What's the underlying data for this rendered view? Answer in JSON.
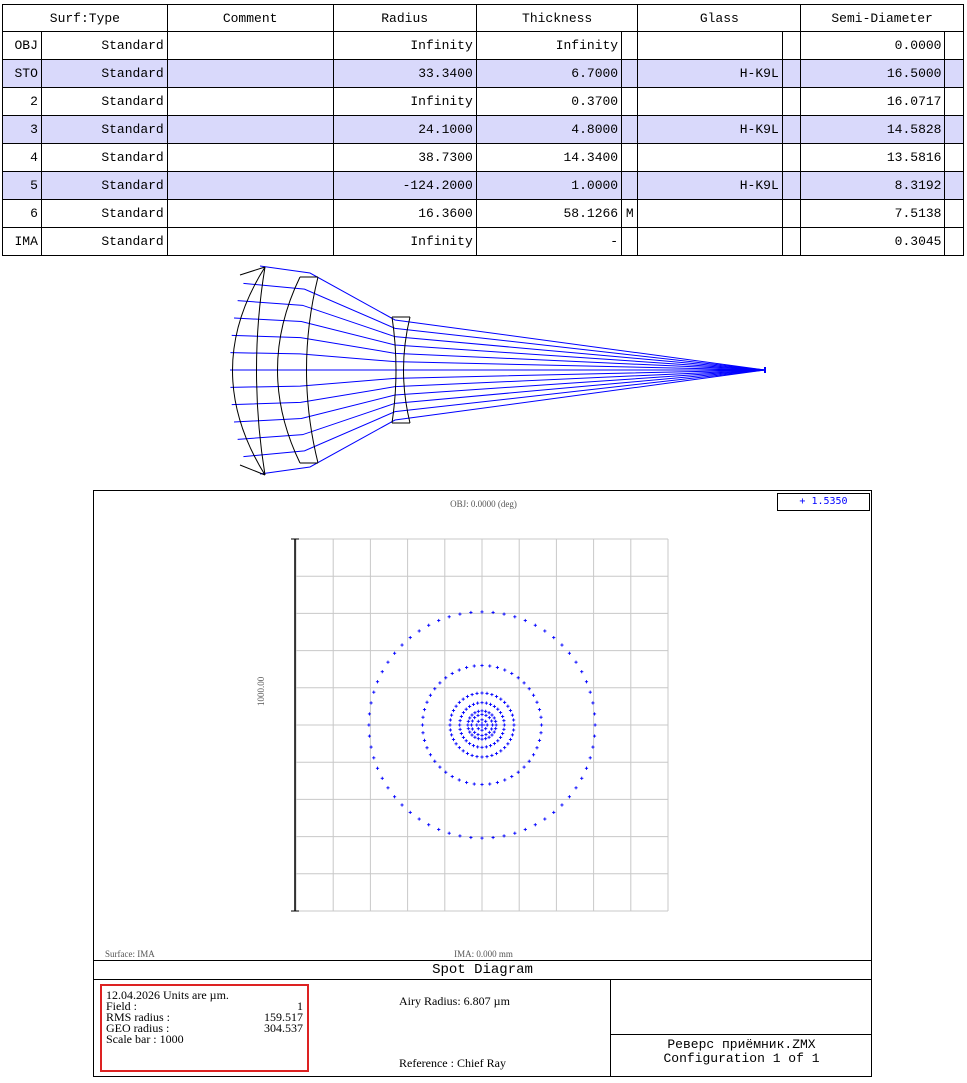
{
  "table": {
    "headers": [
      "Surf:Type",
      "Comment",
      "Radius",
      "Thickness",
      "Glass",
      "Semi-Diameter"
    ],
    "rows": [
      {
        "surf": "OBJ",
        "type": "Standard",
        "comment": "",
        "radius": "Infinity",
        "thickness": "Infinity",
        "tflag": "",
        "glass": "",
        "semi": "0.0000",
        "selected": false
      },
      {
        "surf": "STO",
        "type": "Standard",
        "comment": "",
        "radius": "33.3400",
        "thickness": "6.7000",
        "tflag": "",
        "glass": "H-K9L",
        "semi": "16.5000",
        "selected": true
      },
      {
        "surf": "2",
        "type": "Standard",
        "comment": "",
        "radius": "Infinity",
        "thickness": "0.3700",
        "tflag": "",
        "glass": "",
        "semi": "16.0717",
        "selected": false
      },
      {
        "surf": "3",
        "type": "Standard",
        "comment": "",
        "radius": "24.1000",
        "thickness": "4.8000",
        "tflag": "",
        "glass": "H-K9L",
        "semi": "14.5828",
        "selected": true
      },
      {
        "surf": "4",
        "type": "Standard",
        "comment": "",
        "radius": "38.7300",
        "thickness": "14.3400",
        "tflag": "",
        "glass": "",
        "semi": "13.5816",
        "selected": false
      },
      {
        "surf": "5",
        "type": "Standard",
        "comment": "",
        "radius": "-124.2000",
        "thickness": "1.0000",
        "tflag": "",
        "glass": "H-K9L",
        "semi": "8.3192",
        "selected": true
      },
      {
        "surf": "6",
        "type": "Standard",
        "comment": "",
        "radius": "16.3600",
        "thickness": "58.1266",
        "tflag": "M",
        "glass": "",
        "semi": "7.5138",
        "selected": false
      },
      {
        "surf": "IMA",
        "type": "Standard",
        "comment": "",
        "radius": "Infinity",
        "thickness": "-",
        "tflag": "",
        "glass": "",
        "semi": "0.3045",
        "selected": false
      }
    ]
  },
  "spot": {
    "obj_label": "OBJ: 0.0000 (deg)",
    "legend": "+ 1.5350",
    "scale_axis_label": "1000.00",
    "surface_label": "Surface: IMA",
    "ima_label": "IMA: 0.000 mm",
    "title": "Spot Diagram",
    "date_line": "12.04.2026  Units are µm.",
    "field_label": "Field      :",
    "field_value": "1",
    "rms_label": "RMS radius :",
    "rms_value": "159.517",
    "geo_label": "GEO radius :",
    "geo_value": "304.537",
    "scale_line": "Scale bar  : 1000",
    "airy": "Airy Radius: 6.807 µm",
    "reference": "Reference  : Chief Ray",
    "file_name": "Реверс приёмник.ZMX",
    "config": "Configuration 1 of 1",
    "ray_color": "#0000ff",
    "ring_radii": [
      304,
      160,
      86,
      60,
      38,
      28,
      14
    ],
    "ring_counts": [
      64,
      48,
      40,
      32,
      24,
      16,
      8
    ]
  },
  "layout_colors": {
    "ray": "#0000ff",
    "lens": "#000000"
  }
}
